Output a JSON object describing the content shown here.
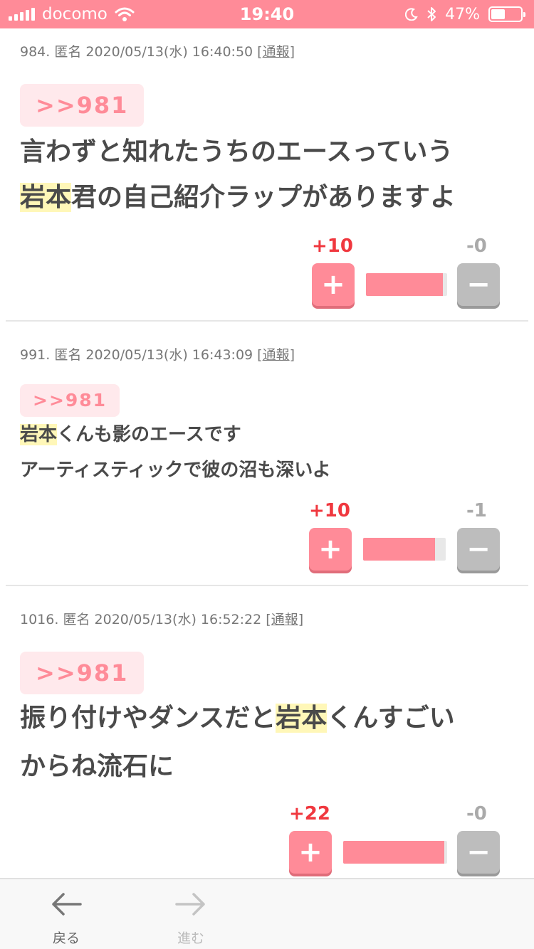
{
  "status_bar": {
    "carrier": "docomo",
    "time": "19:40",
    "battery": "47%",
    "battery_level": 0.47
  },
  "posts": [
    {
      "number": "984.",
      "author": "匿名",
      "datetime": "2020/05/13(水) 16:40:50",
      "report_label": "通報",
      "anchor": ">>981",
      "lines": [
        [
          {
            "t": "言わずと知れたうちのエースっていう",
            "h": false
          }
        ],
        [
          {
            "t": "岩本",
            "h": true
          },
          {
            "t": "君の自己紹介ラップがありますよ",
            "h": false
          }
        ]
      ],
      "plus_count": "+10",
      "minus_count": "-0",
      "plus_ratio": 0.95
    },
    {
      "number": "991.",
      "author": "匿名",
      "datetime": "2020/05/13(水) 16:43:09",
      "report_label": "通報",
      "anchor": ">>981",
      "lines": [
        [
          {
            "t": "岩本",
            "h": true
          },
          {
            "t": "くんも影のエースです",
            "h": false
          }
        ],
        [
          {
            "t": "アーティスティックで彼の沼も深いよ",
            "h": false
          }
        ]
      ],
      "plus_count": "+10",
      "minus_count": "-1",
      "plus_ratio": 0.87
    },
    {
      "number": "1016.",
      "author": "匿名",
      "datetime": "2020/05/13(水) 16:52:22",
      "report_label": "通報",
      "anchor": ">>981",
      "lines": [
        [
          {
            "t": "振り付けやダンスだと",
            "h": false
          },
          {
            "t": "岩本",
            "h": true
          },
          {
            "t": "くんすごい",
            "h": false
          }
        ],
        [
          {
            "t": "からね流石に",
            "h": false
          }
        ]
      ],
      "plus_count": "+22",
      "minus_count": "-0",
      "plus_ratio": 0.97
    }
  ],
  "vote": {
    "plus_symbol": "+",
    "minus_symbol": "−"
  },
  "toolbar": {
    "back_label": "戻る",
    "forward_label": "進む"
  },
  "icons": {
    "back": "arrow-left-icon",
    "forward": "arrow-right-icon"
  },
  "colors": {
    "accent": "#ff8b98",
    "plus_count": "#f0383f",
    "highlight": "#fff7b8"
  }
}
